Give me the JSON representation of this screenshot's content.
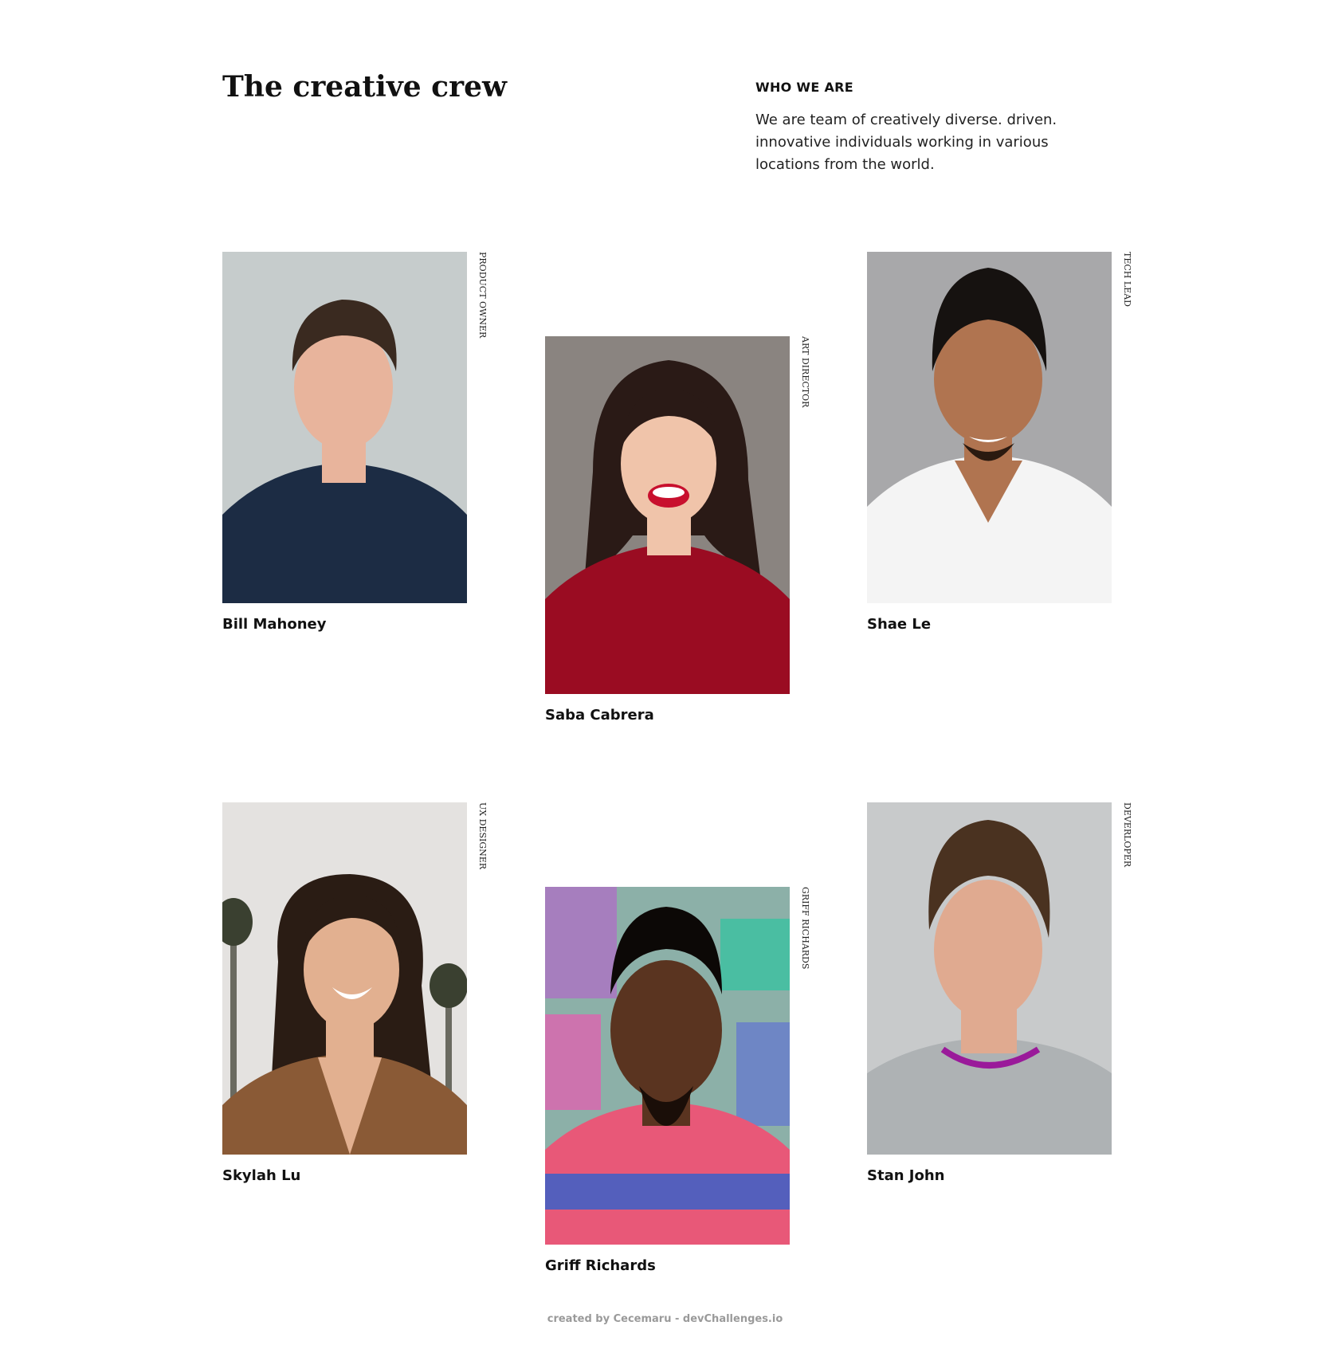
{
  "header": {
    "title": "The creative crew",
    "about_heading": "WHO WE ARE",
    "about_text": "We are team of creatively diverse. driven. innovative individuals working in various locations from the world."
  },
  "team": [
    {
      "name": "Bill Mahoney",
      "role": "PRODUCT OWNER",
      "photo": {
        "bg": "#c6cccc",
        "skin": "#e8b49c",
        "hair": "#3a2a20",
        "shirt": "#1c2c44"
      }
    },
    {
      "name": "Saba Cabrera",
      "role": "ART DIRECTOR",
      "photo": {
        "bg": "#8a8480",
        "skin": "#f0c4aa",
        "hair": "#2a1a16",
        "shirt": "#9a0c22"
      }
    },
    {
      "name": "Shae Le",
      "role": "TECH LEAD",
      "photo": {
        "bg": "#a8a8aa",
        "skin": "#b07450",
        "hair": "#161210",
        "shirt": "#f4f4f4"
      }
    },
    {
      "name": "Skylah Lu",
      "role": "UX DESIGNER",
      "photo": {
        "bg": "#e4e2e0",
        "skin": "#e2b090",
        "hair": "#2a1c14",
        "shirt": "#8a5a36"
      }
    },
    {
      "name": "Griff Richards",
      "role": "GRIFF RICHARDS",
      "photo": {
        "bg": "#8cb0a8",
        "skin": "#5a3420",
        "hair": "#0c0806",
        "shirt": "#e85878"
      }
    },
    {
      "name": "Stan John",
      "role": "DEVERLOPER",
      "photo": {
        "bg": "#c8cacb",
        "skin": "#e0aa90",
        "hair": "#4a3220",
        "shirt": "#aeb2b4"
      }
    }
  ],
  "footer": {
    "text": "created by Cecemaru - devChallenges.io"
  }
}
